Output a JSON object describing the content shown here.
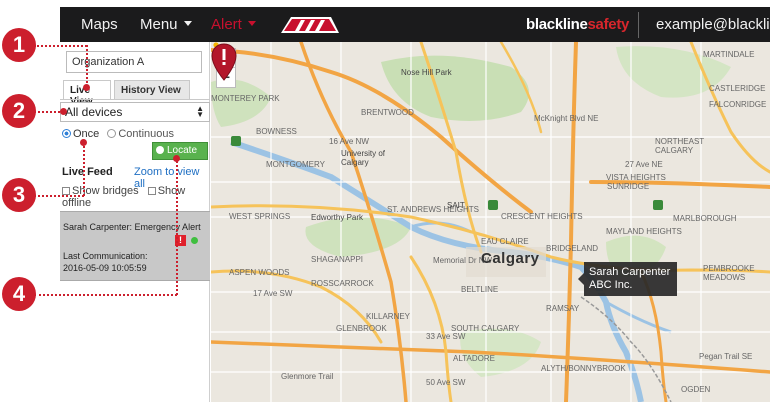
{
  "topbar": {
    "maps": "Maps",
    "menu": "Menu",
    "alert": "Alert",
    "brand_a": "blackline",
    "brand_b": "safety",
    "user": "example@blacklin"
  },
  "sidebar": {
    "org_value": "Organization A",
    "tab_live": "Live View",
    "tab_history": "History View",
    "device_select": "All devices",
    "radio_once": "Once",
    "radio_continuous": "Continuous",
    "locate_label": "Locate",
    "live_feed": "Live Feed",
    "zoom_all": "Zoom to view all",
    "show_bridges": "Show bridges",
    "show_offline": "Show offline"
  },
  "feed_card": {
    "name": "Sarah Carpenter: Emergency Alert",
    "badge": "!",
    "last_comm_label": "Last Communication:",
    "timestamp": "2016-05-09 10:05:59"
  },
  "map": {
    "zoom_in": "+",
    "zoom_out": "−",
    "city": "Calgary",
    "tooltip_name": "Sarah Carpenter",
    "tooltip_org": "ABC Inc.",
    "labels": {
      "nose_hill": "Nose Hill Park",
      "brentwood": "BRENTWOOD",
      "university": "University of Calgary",
      "edworthy": "Edworthy Park",
      "shaganappi": "SHAGANAPPI",
      "rosscarrock": "ROSSCARROCK",
      "aspen": "ASPEN WOODS",
      "killarney": "KILLARNEY",
      "glenbrook": "GLENBROOK",
      "altadore": "ALTADORE",
      "beltline": "BELTLINE",
      "south_calgary": "SOUTH CALGARY",
      "bowness": "BOWNESS",
      "montgomery": "MONTGOMERY",
      "st_andrews": "ST. ANDREWS HEIGHTS",
      "crescent": "CRESCENT HEIGHTS",
      "eau_claire": "EAU CLAIRE",
      "bridgeland": "BRIDGELAND",
      "mayland": "MAYLAND HEIGHTS",
      "vista": "VISTA HEIGHTS",
      "sunridge": "SUNRIDGE",
      "marlborough": "MARLBOROUGH",
      "pembrooke": "PEMBROOKE MEADOWS",
      "castleridge": "CASTLERIDGE",
      "falconridge": "FALCONRIDGE",
      "martindale": "MARTINDALE",
      "ramsay": "RAMSAY",
      "alyth": "ALYTH/BONNYBROOK",
      "ogden": "OGDEN",
      "sait": "SAIT",
      "northeast": "NORTHEAST CALGARY",
      "west_springs": "WEST SPRINGS",
      "monterey": "MONTEREY PARK",
      "mcknight": "McKnight Blvd NE",
      "memorial": "Memorial Dr NW",
      "ave_16": "16 Ave NW",
      "ave_17": "17 Ave SW",
      "ave_33": "33 Ave SW",
      "ave_50": "50 Ave SW",
      "ave_27": "27 Ave NE",
      "pegan": "Pegan Trail SE",
      "glenmore": "Glenmore Trail"
    }
  },
  "steps": [
    "1",
    "2",
    "3",
    "4"
  ]
}
